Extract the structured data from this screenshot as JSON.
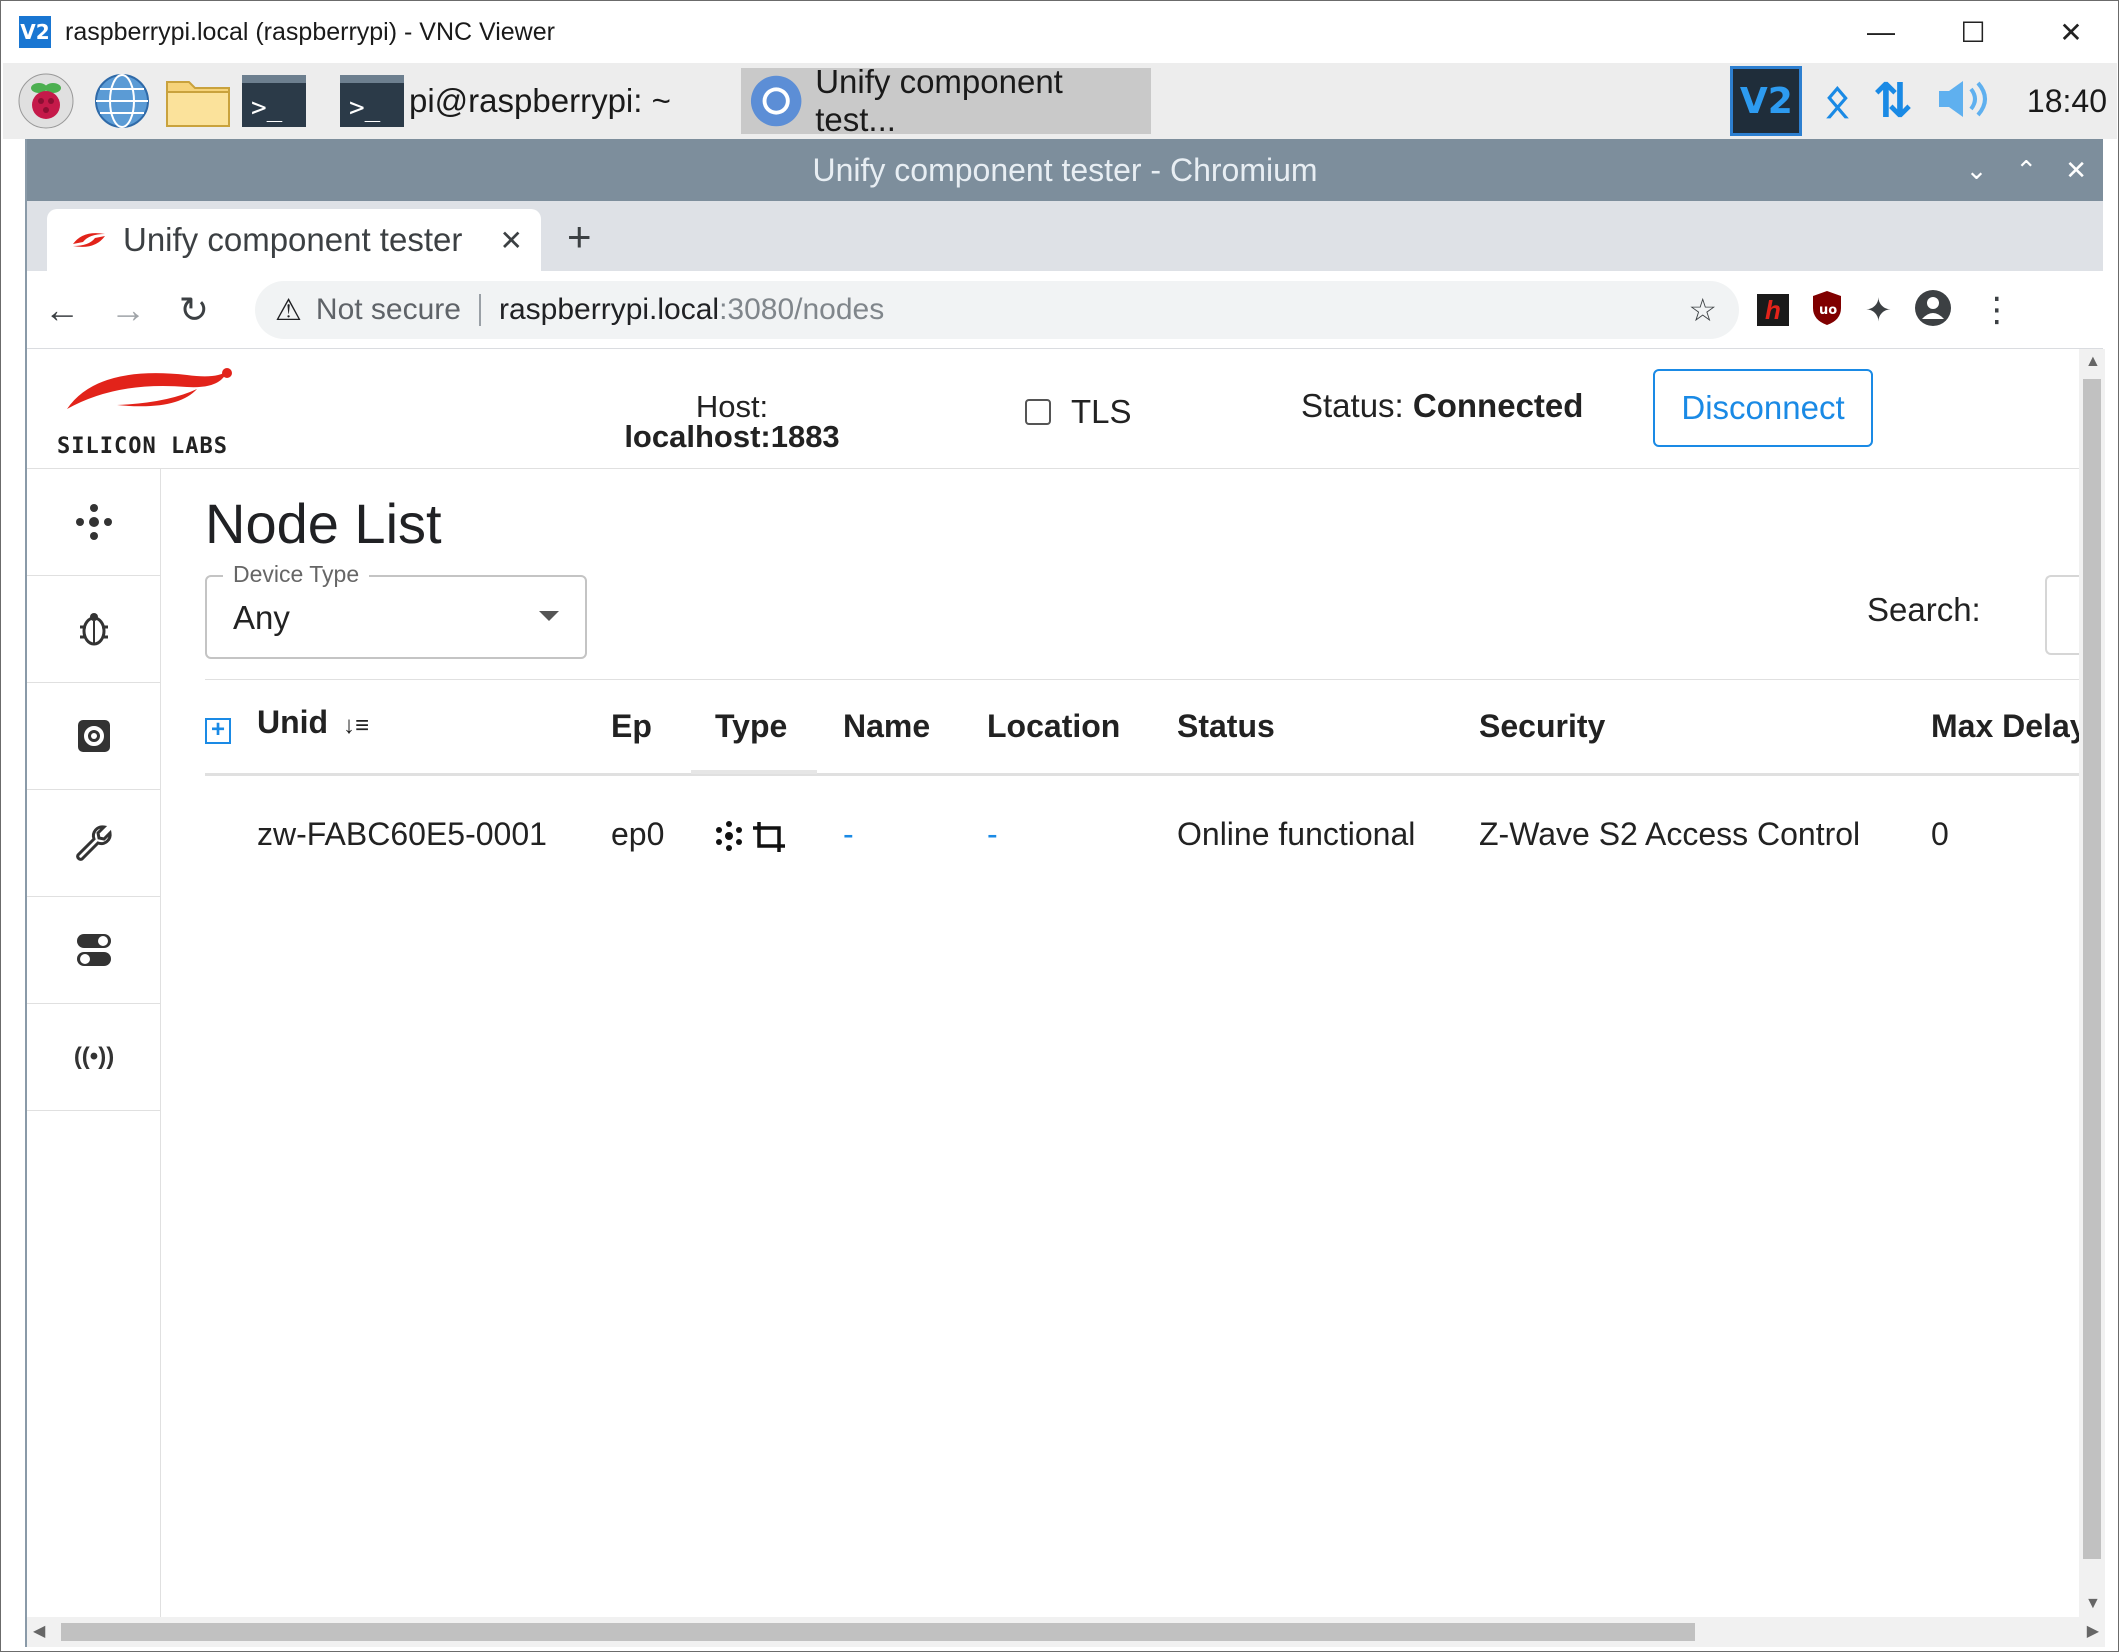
{
  "vnc": {
    "app_icon": "V2",
    "title": "raspberrypi.local (raspberrypi) - VNC Viewer"
  },
  "panel": {
    "terminal_task": "pi@raspberrypi: ~",
    "chromium_task": "Unify component test...",
    "clock": "18:40",
    "icons": [
      "raspberry-menu-icon",
      "browser-globe-icon",
      "file-manager-icon",
      "terminal-icon",
      "vnc-server-icon",
      "bluetooth-icon",
      "network-arrows-icon",
      "volume-icon"
    ]
  },
  "chromium": {
    "window_title": "Unify component tester - Chromium",
    "tab_title": "Unify component tester",
    "new_tab": "+",
    "not_secure": "Not secure",
    "url_host": "raspberrypi.local",
    "url_path": ":3080/nodes"
  },
  "header": {
    "host_label": "Host:",
    "host_value": "localhost:1883",
    "tls_label": "TLS",
    "status_label": "Status:",
    "status_value": "Connected",
    "disconnect_label": "Disconnect",
    "logo_text": "SILICON LABS"
  },
  "nav": {
    "items": [
      "nodes-icon",
      "bug-icon",
      "settings-cog-icon",
      "wrench-icon",
      "toggles-icon",
      "broadcast-icon"
    ]
  },
  "main": {
    "title": "Node List",
    "device_type_label": "Device Type",
    "device_type_value": "Any",
    "search_label": "Search:"
  },
  "table": {
    "columns": [
      "Unid",
      "Ep",
      "Type",
      "Name",
      "Location",
      "Status",
      "Security",
      "Max Delay"
    ],
    "rows": [
      {
        "unid": "zw-FABC60E5-0001",
        "ep": "ep0",
        "name": "-",
        "location": "-",
        "status": "Online functional",
        "security": "Z-Wave S2 Access Control",
        "max_delay": "0"
      }
    ]
  },
  "colors": {
    "accent": "#1a8ae5",
    "logo_red": "#e2231a",
    "chrome_title_bg": "#7d8e9c"
  }
}
